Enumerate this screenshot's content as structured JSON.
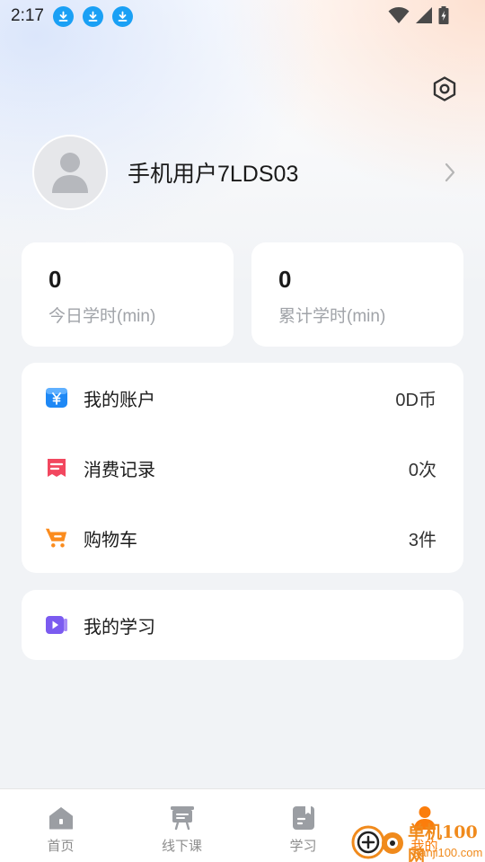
{
  "status_bar": {
    "time": "2:17",
    "download_icons": [
      "download-icon",
      "download-icon",
      "download-icon"
    ],
    "right_icons": [
      "wifi-icon",
      "signal-icon",
      "battery-charging-icon"
    ]
  },
  "header": {
    "settings_icon": "settings-hexagon-icon"
  },
  "profile": {
    "username": "手机用户7LDS03"
  },
  "stats": [
    {
      "value": "0",
      "label": "今日学时(min)"
    },
    {
      "value": "0",
      "label": "累计学时(min)"
    }
  ],
  "menu": [
    {
      "label": "我的账户",
      "value": "0D币",
      "icon": "wallet-yen-icon",
      "color": "#1e88f5"
    },
    {
      "label": "消费记录",
      "value": "0次",
      "icon": "receipt-icon",
      "color": "#f2475f"
    },
    {
      "label": "购物车",
      "value": "3件",
      "icon": "cart-icon",
      "color": "#fb8c1e"
    }
  ],
  "study": {
    "label": "我的学习",
    "icon": "play-video-icon",
    "color": "#7b5bf0"
  },
  "tabs": [
    {
      "label": "首页",
      "icon": "home-icon"
    },
    {
      "label": "线下课",
      "icon": "classroom-icon"
    },
    {
      "label": "学习",
      "icon": "book-icon"
    },
    {
      "label": "我的",
      "icon": "person-icon",
      "active": true
    }
  ],
  "watermark": {
    "text": "单机100网",
    "url": "danji100.com"
  },
  "colors": {
    "accent": "#fb7d0c",
    "background": "#f1f3f6",
    "download": "#1aa0f5"
  }
}
